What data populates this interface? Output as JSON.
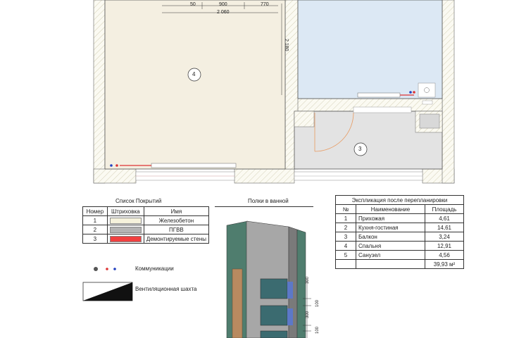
{
  "plan": {
    "dims": {
      "d50": "50",
      "d900": "900",
      "d770": "770",
      "d2060": "2 060",
      "d2180": "2 180"
    },
    "rooms": {
      "r4": "4",
      "r3": "3"
    }
  },
  "coverings": {
    "title": "Список Покрытий",
    "headers": [
      "Номер",
      "Штриховка",
      "Имя"
    ],
    "rows": [
      {
        "num": "1",
        "name": "Железобетон",
        "swatch": "#f6f2dc"
      },
      {
        "num": "2",
        "name": "ПГВВ",
        "swatch": "#b4b4b4"
      },
      {
        "num": "3",
        "name": "Демонтируемые стены",
        "swatch": "#f04040"
      }
    ]
  },
  "legend": {
    "communications": "Коммуникации",
    "ventilation": "Вентиляционная шахта"
  },
  "shelves": {
    "title": "Полки в ванной",
    "dims": [
      "300",
      "100",
      "300",
      "100"
    ]
  },
  "explication": {
    "title": "Экспликация после перепланировки",
    "headers": [
      "№",
      "Наименование",
      "Площадь"
    ],
    "rows": [
      {
        "num": "1",
        "name": "Прихожая",
        "area": "4,61"
      },
      {
        "num": "2",
        "name": "Кухня-гостиная",
        "area": "14,61"
      },
      {
        "num": "3",
        "name": "Балкон",
        "area": "3,24"
      },
      {
        "num": "4",
        "name": "Спальня",
        "area": "12,91"
      },
      {
        "num": "5",
        "name": "Санузел",
        "area": "4,56"
      }
    ],
    "total": "39,93 м²"
  },
  "colors": {
    "concrete": "#f6f2dc",
    "gvl": "#b4b4b4",
    "demolish": "#f04040",
    "blueRoom": "#dce8f4"
  }
}
